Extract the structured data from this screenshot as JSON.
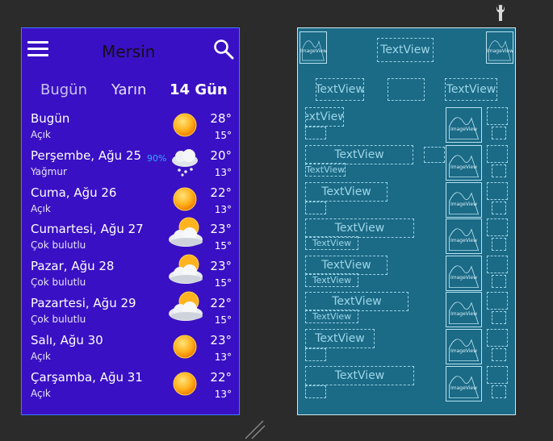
{
  "header": {
    "city": "Mersin"
  },
  "tabs": [
    {
      "label": "Bugün"
    },
    {
      "label": "Yarın"
    },
    {
      "label": "14 Gün"
    }
  ],
  "days": [
    {
      "name": "Bugün",
      "condition": "Açık",
      "high": "28°",
      "low": "15°",
      "icon": "sun-icon"
    },
    {
      "name": "Perşembe, Ağu 25",
      "condition": "Yağmur",
      "high": "20°",
      "low": "13°",
      "precip": "90%",
      "icon": "snow-cloud-icon"
    },
    {
      "name": "Cuma, Ağu 26",
      "condition": "Açık",
      "high": "22°",
      "low": "13°",
      "icon": "sun-icon"
    },
    {
      "name": "Cumartesi, Ağu 27",
      "condition": "Çok bulutlu",
      "high": "23°",
      "low": "15°",
      "icon": "sun-cloud-icon"
    },
    {
      "name": "Pazar, Ağu 28",
      "condition": "Çok bulutlu",
      "high": "23°",
      "low": "15°",
      "icon": "sun-cloud-icon"
    },
    {
      "name": "Pazartesi, Ağu 29",
      "condition": "Çok bulutlu",
      "high": "22°",
      "low": "15°",
      "icon": "sun-cloud-icon"
    },
    {
      "name": "Salı, Ağu 30",
      "condition": "Açık",
      "high": "23°",
      "low": "13°",
      "icon": "sun-icon"
    },
    {
      "name": "Çarşamba, Ağu 31",
      "condition": "Açık",
      "high": "22°",
      "low": "13°",
      "icon": "sun-icon"
    }
  ],
  "blueprint": {
    "textview_label": "TextView",
    "textview_label_clipped": "extView",
    "imageview_label": "ImageView"
  },
  "colors": {
    "background": "#2b2b2b",
    "phone_background": "#3a10c4",
    "phone_border": "#3d7bff",
    "blueprint_background": "#1b6a86",
    "precip_color": "#33a9ff"
  }
}
